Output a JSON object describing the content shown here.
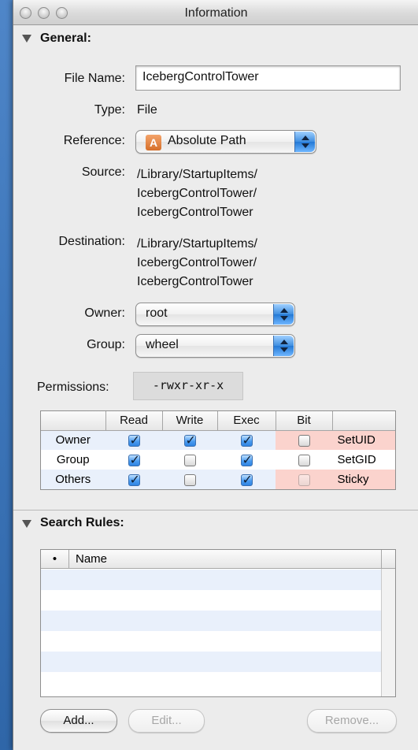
{
  "window": {
    "title": "Information"
  },
  "general": {
    "header": "General:",
    "file_name_label": "File Name:",
    "file_name_value": "IcebergControlTower",
    "type_label": "Type:",
    "type_value": "File",
    "reference_label": "Reference:",
    "reference_value": "Absolute Path",
    "reference_icon_letter": "A",
    "source_label": "Source:",
    "source_lines": [
      "/Library/StartupItems/",
      "IcebergControlTower/",
      "IcebergControlTower"
    ],
    "destination_label": "Destination:",
    "destination_lines": [
      "/Library/StartupItems/",
      "IcebergControlTower/",
      "IcebergControlTower"
    ],
    "owner_label": "Owner:",
    "owner_value": "root",
    "group_label": "Group:",
    "group_value": "wheel",
    "permissions_label": "Permissions:",
    "permissions_value": "-rwxr-xr-x"
  },
  "permissions_table": {
    "headers": [
      "",
      "Read",
      "Write",
      "Exec",
      "Bit",
      ""
    ],
    "rows": [
      {
        "label": "Owner",
        "read": true,
        "write": true,
        "exec": true,
        "bit": false,
        "bit_name": "SetUID"
      },
      {
        "label": "Group",
        "read": true,
        "write": false,
        "exec": true,
        "bit": false,
        "bit_name": "SetGID"
      },
      {
        "label": "Others",
        "read": true,
        "write": false,
        "exec": true,
        "bit": false,
        "bit_name": "Sticky"
      }
    ]
  },
  "search_rules": {
    "header": "Search Rules:",
    "columns": [
      "•",
      "Name"
    ],
    "rows": []
  },
  "buttons": {
    "add": "Add...",
    "edit": "Edit...",
    "remove": "Remove..."
  },
  "colors": {
    "desktop": "#3f78bc",
    "accent_blue": "#2f84e2",
    "bit_highlight": "#fbd3cd",
    "stripe": "#e9f0fb"
  }
}
